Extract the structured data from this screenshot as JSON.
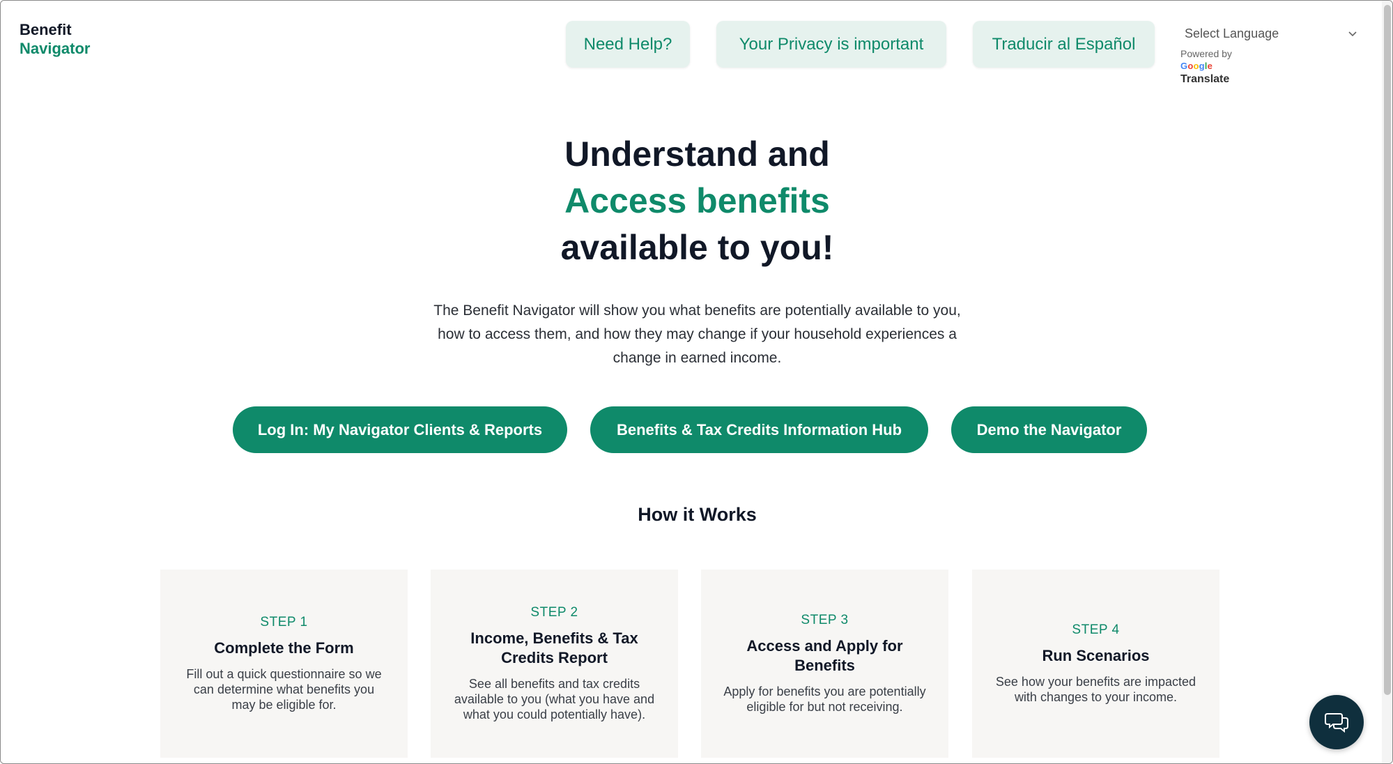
{
  "logo": {
    "line1": "Benefit",
    "line2": "Navigator"
  },
  "header": {
    "help_label": "Need Help?",
    "privacy_label": "Your Privacy is important",
    "spanish_label": "Traducir al Español"
  },
  "language": {
    "select_value": "Select Language",
    "powered_by": "Powered by",
    "google": [
      "G",
      "o",
      "o",
      "g",
      "l",
      "e"
    ],
    "translate": "Translate"
  },
  "hero": {
    "line1": "Understand and",
    "accent": "Access benefits",
    "line3": "available to you!",
    "description": "The Benefit Navigator will show you what benefits are potentially available to you, how to access them, and how they may change if your household experiences a change in earned income."
  },
  "cta": {
    "login": "Log In: My Navigator Clients & Reports",
    "hub": "Benefits & Tax Credits Information Hub",
    "demo": "Demo the Navigator"
  },
  "how_it_works": "How it Works",
  "steps": [
    {
      "step": "STEP 1",
      "title": "Complete the Form",
      "desc": "Fill out a quick questionnaire so we can determine what benefits you may be eligible for."
    },
    {
      "step": "STEP 2",
      "title": "Income, Benefits & Tax Credits Report",
      "desc": "See all benefits and tax credits available to you (what you have and what you could potentially have)."
    },
    {
      "step": "STEP 3",
      "title": "Access and Apply for Benefits",
      "desc": "Apply for benefits you are potentially eligible for but not receiving."
    },
    {
      "step": "STEP 4",
      "title": "Run Scenarios",
      "desc": "See how your benefits are impacted with changes to your income."
    }
  ],
  "colors": {
    "brand": "#0f8a6a",
    "brand_light": "#e6f2ee",
    "chat": "#0f2f3d",
    "card_bg": "#f7f6f4"
  },
  "icons": {
    "chat": "chat-bubble-icon",
    "select": "chevron-down-icon"
  }
}
